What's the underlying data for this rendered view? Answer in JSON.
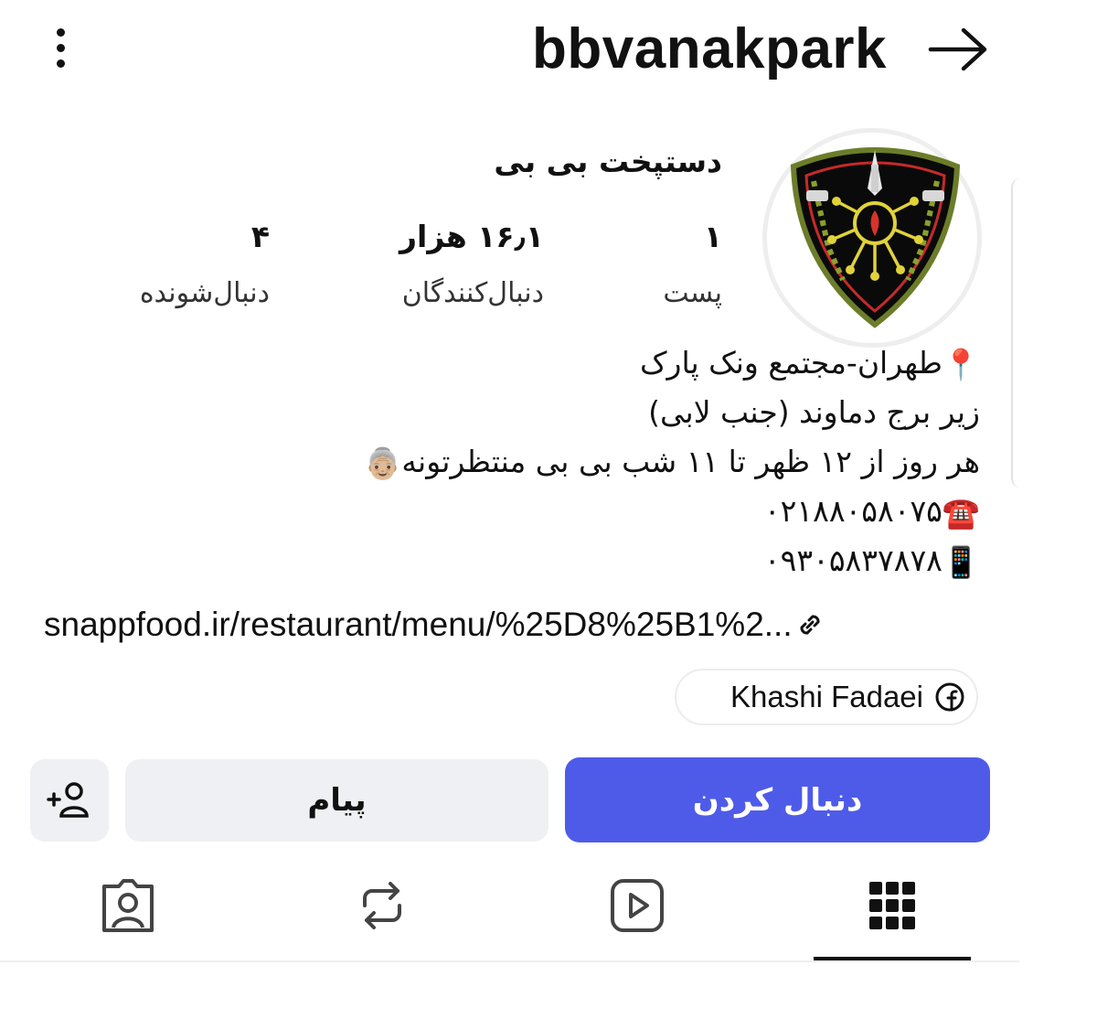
{
  "header": {
    "username": "bbvanakpark",
    "menu_icon": "more-vertical-icon",
    "back_icon": "arrow-right-icon"
  },
  "profile": {
    "avatar_icon": "emblem-logo",
    "full_name": "دستپخت بی بی",
    "stats": {
      "posts": {
        "value": "۱",
        "label": "پست"
      },
      "followers": {
        "value": "۱۶٫۱ هزار",
        "label": "دنبال‌کنندگان"
      },
      "following": {
        "value": "۴",
        "label": "دنبال‌شونده"
      }
    }
  },
  "bio": {
    "line1_emoji": "📍",
    "line1": "طهران-مجتمع ونک پارک",
    "line2": "زیر برج دماوند (جنب لابی)",
    "line3": "هر روز از ۱۲ ظهر تا ۱۱ شب بی بی منتظرتونه",
    "line3_emoji": "👵🏼",
    "phone_emoji": "☎️",
    "phone": "۰۲۱۸۸۰۵۸۰۷۵",
    "mobile_emoji": "📱",
    "mobile": "۰۹۳۰۵۸۳۷۸۷۸"
  },
  "link": {
    "text": "snappfood.ir/restaurant/menu/%25D8%25B1%2...",
    "icon": "link-icon"
  },
  "facebook_chip": {
    "text": "Khashi Fadaei",
    "icon": "facebook-icon"
  },
  "actions": {
    "follow_label": "دنبال کردن",
    "message_label": "پیام",
    "add_person_icon": "add-person-icon"
  },
  "tabs": [
    {
      "name": "grid",
      "icon": "grid-icon",
      "selected": true
    },
    {
      "name": "reels",
      "icon": "reels-play-icon",
      "selected": false
    },
    {
      "name": "reposts",
      "icon": "repost-icon",
      "selected": false
    },
    {
      "name": "tagged",
      "icon": "tagged-person-icon",
      "selected": false
    }
  ],
  "colors": {
    "follow_button": "#4e5be9",
    "secondary_button": "#eef0f3",
    "text": "#111111"
  }
}
